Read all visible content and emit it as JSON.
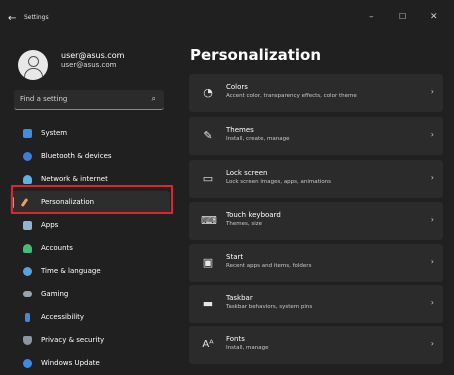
{
  "window": {
    "title": "Settings",
    "controls": {
      "minimize": "–",
      "maximize": "☐",
      "close": "✕"
    }
  },
  "user": {
    "name": "user@asus.com",
    "email": "user@asus.com"
  },
  "search": {
    "placeholder": "Find a setting"
  },
  "sidebar": {
    "items": [
      {
        "label": "System",
        "icon": "monitor-icon",
        "color": "#3a8ee6"
      },
      {
        "label": "Bluetooth & devices",
        "icon": "bluetooth-icon",
        "color": "#3b7de0"
      },
      {
        "label": "Network & internet",
        "icon": "wifi-icon",
        "color": "#5ab0e8"
      },
      {
        "label": "Personalization",
        "icon": "brush-icon",
        "color": "#e8a060",
        "active": true
      },
      {
        "label": "Apps",
        "icon": "apps-icon",
        "color": "#8fb3d6"
      },
      {
        "label": "Accounts",
        "icon": "person-icon",
        "color": "#3fbf7a"
      },
      {
        "label": "Time & language",
        "icon": "globe-icon",
        "color": "#4fa6e0"
      },
      {
        "label": "Gaming",
        "icon": "gamepad-icon",
        "color": "#9aa4ad"
      },
      {
        "label": "Accessibility",
        "icon": "accessibility-icon",
        "color": "#3c8ae8"
      },
      {
        "label": "Privacy & security",
        "icon": "shield-icon",
        "color": "#8d96a0"
      },
      {
        "label": "Windows Update",
        "icon": "update-icon",
        "color": "#3c8ae8"
      }
    ]
  },
  "main": {
    "title": "Personalization",
    "cards": [
      {
        "title": "Colors",
        "desc": "Accent color, transparency effects, color theme",
        "icon": "palette-icon"
      },
      {
        "title": "Themes",
        "desc": "Install, create, manage",
        "icon": "pen-icon"
      },
      {
        "title": "Lock screen",
        "desc": "Lock screen images, apps, animations",
        "icon": "lock-screen-icon"
      },
      {
        "title": "Touch keyboard",
        "desc": "Themes, size",
        "icon": "keyboard-icon"
      },
      {
        "title": "Start",
        "desc": "Recent apps and items, folders",
        "icon": "start-icon"
      },
      {
        "title": "Taskbar",
        "desc": "Taskbar behaviors, system pins",
        "icon": "taskbar-icon"
      },
      {
        "title": "Fonts",
        "desc": "Install, manage",
        "icon": "fonts-icon"
      }
    ]
  }
}
